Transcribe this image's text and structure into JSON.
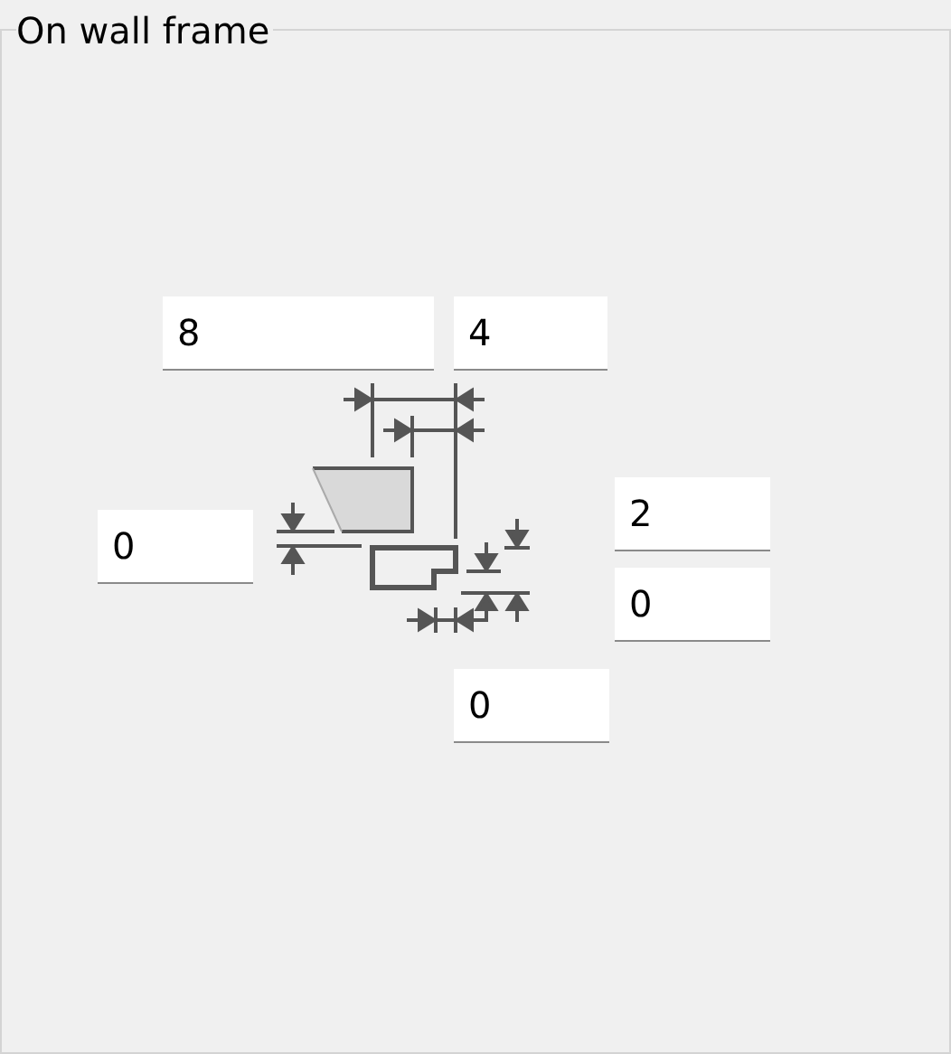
{
  "group": {
    "title": "On wall frame"
  },
  "fields": [
    {
      "value": "8"
    },
    {
      "value": "4"
    },
    {
      "value": "0"
    },
    {
      "value": "2"
    },
    {
      "value": "0"
    },
    {
      "value": "0"
    }
  ]
}
